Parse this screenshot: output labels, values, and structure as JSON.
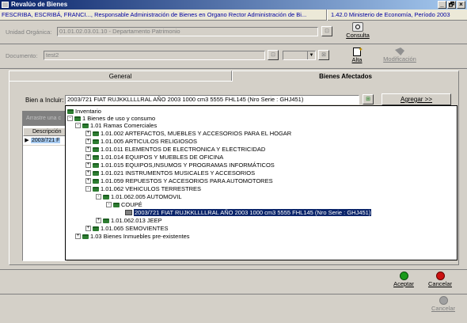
{
  "window": {
    "title": "Revalúo de Bienes",
    "controls": [
      "_",
      "🗗",
      "×"
    ]
  },
  "infobar": {
    "left": "FESCRIBA, ESCRIBÁ, FRANCI..., Responsable Administración de Bienes en Organo Rector Administración de Bi...",
    "right": "1.42.0 Ministerio de Economía, Período 2003"
  },
  "unidad": {
    "label": "Unidad Orgánica:",
    "value": "01.01.02.03.01.10 - Departamento Patrimonio"
  },
  "consulta": {
    "label": "Consulta"
  },
  "documento": {
    "label": "Documento:",
    "value": "test2"
  },
  "alta": {
    "label": "Alta"
  },
  "modificacion": {
    "label": "Modificación"
  },
  "tabs": {
    "general": "General",
    "bienes": "Bienes Afectados"
  },
  "bien": {
    "label": "Bien a Incluir:",
    "value": "2003/721 FIAT RUJKKLLLLRAL AÑO  2003 1000 cm3  5555 FHL145 (Nro Serie : GHJ451)"
  },
  "agregar": {
    "label": "Agregar >>"
  },
  "grid": {
    "group_hint": "Arrastre una c",
    "header": "Descripción",
    "row": "2003/721 F"
  },
  "tree": {
    "root": "Inventario",
    "n1": "1 Bienes de uso y consumo",
    "n101": "1.01 Ramas Comerciales",
    "c1": "1.01.002 ARTEFACTOS,  MUEBLES Y ACCESORIOS PARA EL HOGAR",
    "c2": "1.01.005 ARTICULOS RELIGIOSOS",
    "c3": "1.01.011 ELEMENTOS DE ELECTRONICA Y ELECTRICIDAD",
    "c4": "1.01.014 EQUIPOS Y MUEBLES DE OFICINA",
    "c5": "1.01.015 EQUIPOS,INSUMOS Y PROGRAMAS INFORMÁTICOS",
    "c6": "1.01.021 INSTRUMENTOS MUSICALES Y ACCESORIOS",
    "c7": "1.01.059 REPUESTOS Y ACCESORIOS PARA AUTOMOTORES",
    "c8": "1.01.062 VEHICULOS TERRESTRES",
    "c8a": "1.01.062.005 AUTOMOVIL",
    "c8a1": "COUPÉ",
    "c8a1x": "2003/721 FIAT RUJKKLLLLRAL AÑO  2003 1000 cm3  5555 FHL145 (Nro Serie : GHJ451)",
    "c8b": "1.01.062.013 JEEP",
    "c9": "1.01.065 SEMOVIENTES",
    "n103": "1.03 Bienes Inmuebles pre-existentes"
  },
  "aceptar": {
    "label": "Aceptar",
    "color": "#1a9a1a"
  },
  "cancelar": {
    "label": "Cancelar",
    "color": "#cc1111"
  },
  "cancelar2": {
    "label": "Cancelar"
  }
}
